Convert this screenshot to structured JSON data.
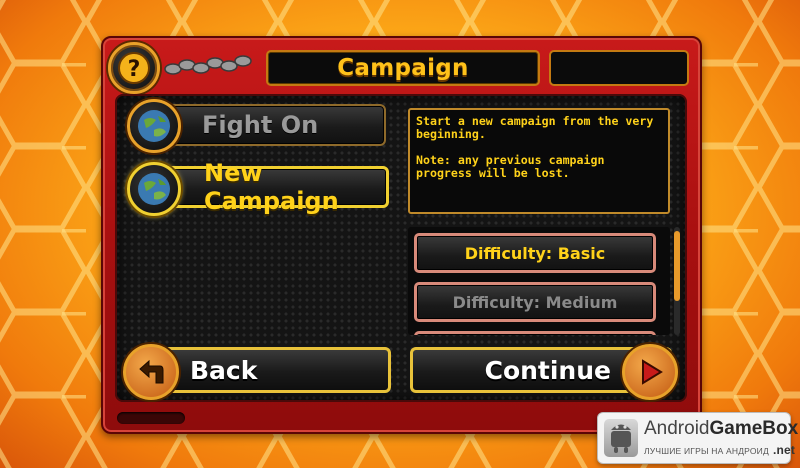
{
  "header": {
    "title": "Campaign"
  },
  "menu": {
    "fight_on": "Fight On",
    "new_campaign": "New Campaign"
  },
  "description": {
    "line1": "Start a new campaign from the very beginning.",
    "line2": "Note: any previous campaign progress will be lost."
  },
  "difficulty": {
    "options": [
      "Difficulty: Basic",
      "Difficulty: Medium"
    ],
    "selected": "Difficulty: Basic"
  },
  "footer": {
    "back": "Back",
    "continue": "Continue"
  },
  "watermark": {
    "title_a": "Android",
    "title_b": "GameBox",
    "subtitle": "ЛУЧШИЕ ИГРЫ НА АНДРОИД",
    "net": ".net"
  },
  "colors": {
    "panel_red": "#a91010",
    "accent_yellow": "#ffd21a",
    "button_border_gold": "#e8c23a",
    "difficulty_border": "#d88a7a"
  }
}
